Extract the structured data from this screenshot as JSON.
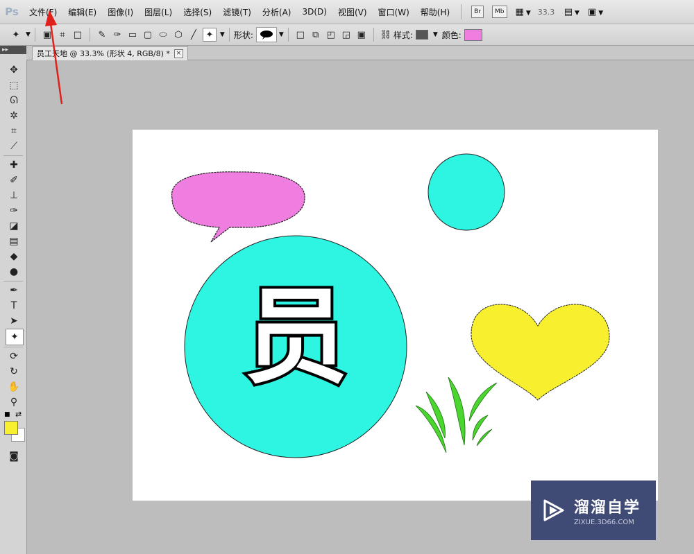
{
  "app": {
    "logo": "Ps"
  },
  "menu": [
    {
      "label": "文件(F)"
    },
    {
      "label": "编辑(E)"
    },
    {
      "label": "图像(I)"
    },
    {
      "label": "图层(L)"
    },
    {
      "label": "选择(S)"
    },
    {
      "label": "滤镜(T)"
    },
    {
      "label": "分析(A)"
    },
    {
      "label": "3D(D)"
    },
    {
      "label": "视图(V)"
    },
    {
      "label": "窗口(W)"
    },
    {
      "label": "帮助(H)"
    }
  ],
  "appbar": {
    "bridge_label": "Br",
    "minibridge_label": "Mb",
    "zoom_value": "33.3"
  },
  "options": {
    "shape_label": "形状:",
    "style_label": "样式:",
    "color_label": "颜色:",
    "style_color": "#555555",
    "fill_color": "#f07de0"
  },
  "document": {
    "tab_title": "员工天地 @ 33.3% (形状 4, RGB/8) *",
    "close_label": "×"
  },
  "canvas_content": {
    "glyph": "员",
    "speech_bubble_color": "#f07de0",
    "circle_color": "#2ef4e2",
    "heart_color": "#f8ef2e",
    "grass_color": "#4bd62f"
  },
  "tools": {
    "foreground_color": "#f8ef2e",
    "background_color": "#ffffff"
  },
  "watermark": {
    "title": "溜溜自学",
    "url": "ZIXUE.3D66.COM"
  },
  "annotation": {
    "arrow_color": "#e0201a"
  }
}
